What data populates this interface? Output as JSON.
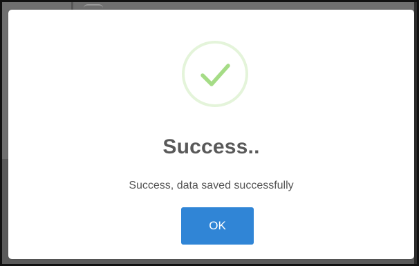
{
  "dialog": {
    "title": "Success..",
    "message": "Success, data saved successfully",
    "confirm_label": "OK",
    "icon": "success-checkmark-icon"
  },
  "colors": {
    "check": "#a5dc86",
    "confirm_button": "#3085d6",
    "title_text": "#595959"
  }
}
